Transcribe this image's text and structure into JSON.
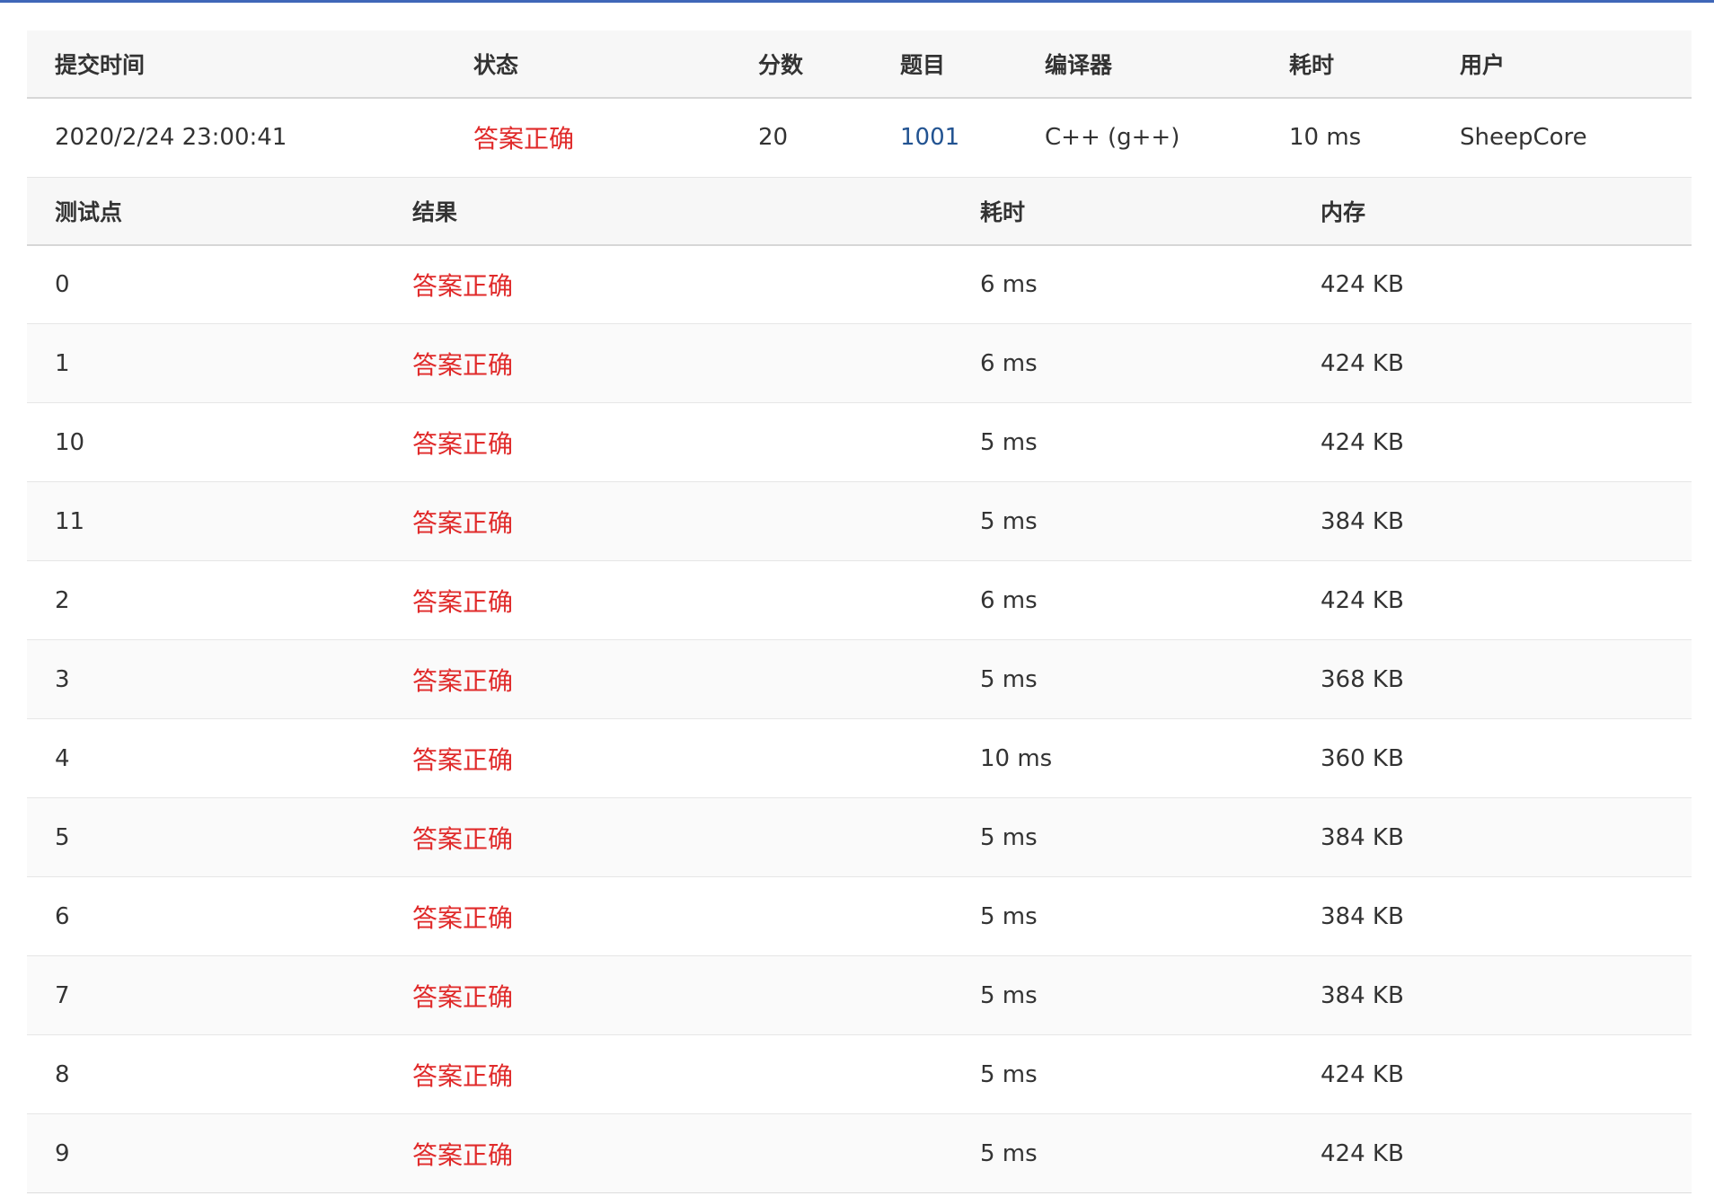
{
  "submission": {
    "headers": [
      "提交时间",
      "状态",
      "分数",
      "题目",
      "编译器",
      "耗时",
      "用户"
    ],
    "row": {
      "time": "2020/2/24 23:00:41",
      "status": "答案正确",
      "score": "20",
      "problem": "1001",
      "compiler": "C++ (g++)",
      "elapsed": "10 ms",
      "user": "SheepCore"
    }
  },
  "tests": {
    "headers": [
      "测试点",
      "结果",
      "耗时",
      "内存"
    ],
    "rows": [
      {
        "case": "0",
        "result": "答案正确",
        "time": "6 ms",
        "memory": "424 KB"
      },
      {
        "case": "1",
        "result": "答案正确",
        "time": "6 ms",
        "memory": "424 KB"
      },
      {
        "case": "10",
        "result": "答案正确",
        "time": "5 ms",
        "memory": "424 KB"
      },
      {
        "case": "11",
        "result": "答案正确",
        "time": "5 ms",
        "memory": "384 KB"
      },
      {
        "case": "2",
        "result": "答案正确",
        "time": "6 ms",
        "memory": "424 KB"
      },
      {
        "case": "3",
        "result": "答案正确",
        "time": "5 ms",
        "memory": "368 KB"
      },
      {
        "case": "4",
        "result": "答案正确",
        "time": "10 ms",
        "memory": "360 KB"
      },
      {
        "case": "5",
        "result": "答案正确",
        "time": "5 ms",
        "memory": "384 KB"
      },
      {
        "case": "6",
        "result": "答案正确",
        "time": "5 ms",
        "memory": "384 KB"
      },
      {
        "case": "7",
        "result": "答案正确",
        "time": "5 ms",
        "memory": "384 KB"
      },
      {
        "case": "8",
        "result": "答案正确",
        "time": "5 ms",
        "memory": "424 KB"
      },
      {
        "case": "9",
        "result": "答案正确",
        "time": "5 ms",
        "memory": "424 KB"
      }
    ]
  },
  "colors": {
    "accent": "#3f67b8",
    "status_ok": "#e02a2a",
    "link": "#225391"
  }
}
